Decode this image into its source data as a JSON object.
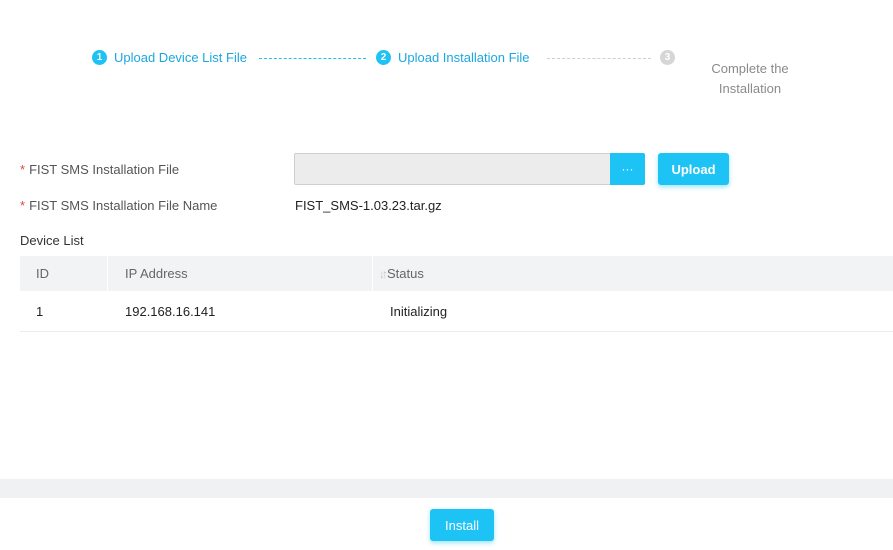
{
  "stepper": {
    "steps": [
      {
        "number": "1",
        "label": "Upload Device List File",
        "state": "completed"
      },
      {
        "number": "2",
        "label": "Upload Installation File",
        "state": "active"
      },
      {
        "number": "3",
        "label": "Complete the Installation",
        "state": "pending"
      }
    ]
  },
  "form": {
    "required_marker": "*",
    "installation_file_label": "FIST SMS Installation File",
    "installation_file_value": "",
    "browse_label": "···",
    "upload_label": "Upload",
    "file_name_label": "FIST SMS Installation File Name",
    "file_name_value": "FIST_SMS-1.03.23.tar.gz"
  },
  "device_list": {
    "title": "Device List",
    "columns": [
      "ID",
      "IP Address",
      "Status"
    ],
    "sort_icon": "sort-arrows-icon",
    "rows": [
      {
        "id": "1",
        "ip": "192.168.16.141",
        "status": "Initializing"
      }
    ]
  },
  "footer": {
    "install_label": "Install"
  },
  "colors": {
    "accent": "#1ec3f5",
    "accent_text": "#1ba8e0",
    "required": "#e2463a",
    "inactive": "#d6d6d6"
  }
}
